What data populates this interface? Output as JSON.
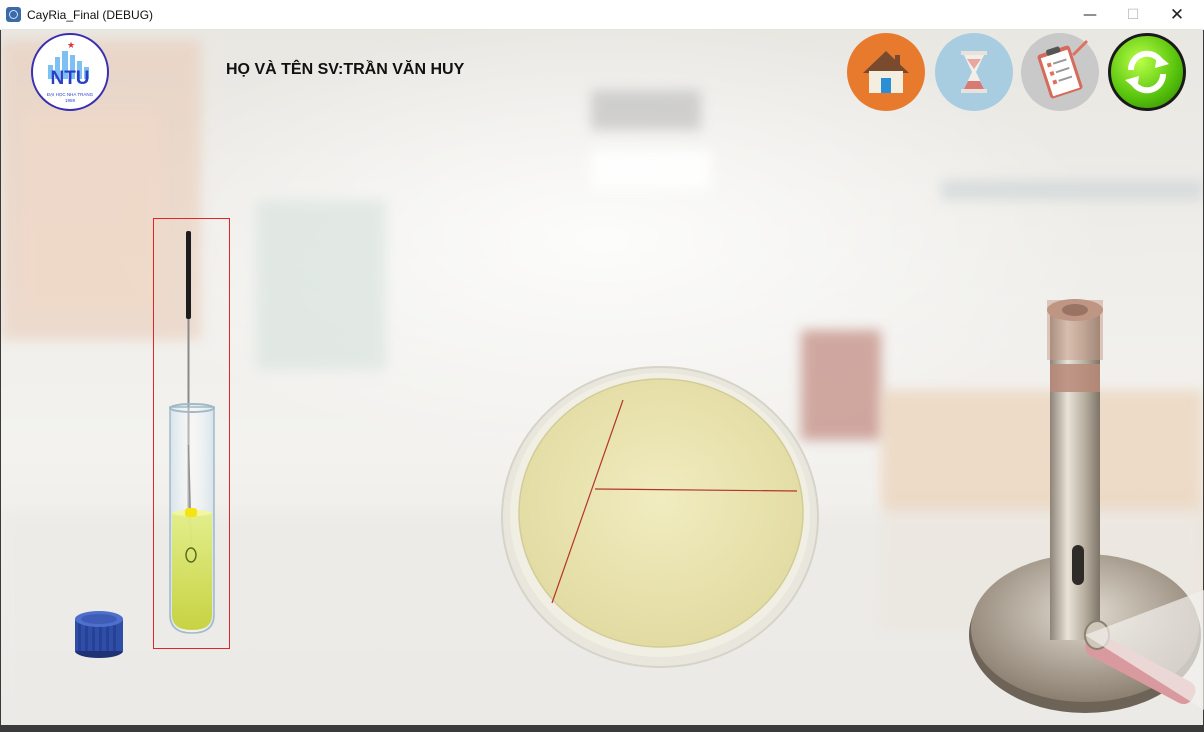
{
  "window": {
    "title": "CayRia_Final (DEBUG)",
    "minimize_glyph": "—",
    "maximize_glyph": "☐",
    "close_glyph": "✕"
  },
  "logo": {
    "text": "NTU",
    "subtitle": "ĐẠI HỌC NHA TRANG",
    "subtitle2": "1959"
  },
  "student": {
    "label": "HỌ VÀ TÊN SV:TRẦN VĂN HUY"
  },
  "toolbar": {
    "home_icon": "home-icon",
    "timer_icon": "hourglass-icon",
    "report_icon": "clipboard-icon",
    "refresh_icon": "refresh-icon"
  },
  "colors": {
    "selection_box": "#e0262b",
    "home_bg": "#e87a2e",
    "timer_bg": "#a9cde0",
    "refresh_green": "#55c10b",
    "agar": "#ece7b3",
    "streak": "#b3362a",
    "cap_blue": "#2f4ea8"
  }
}
